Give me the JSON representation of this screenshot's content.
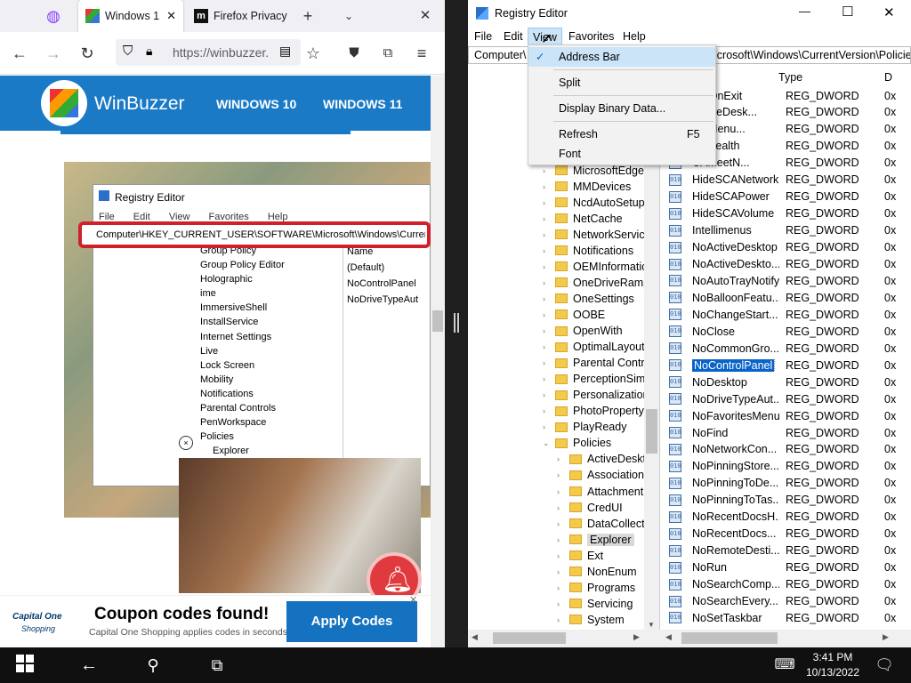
{
  "firefox": {
    "tabs": [
      {
        "label": "Windows 1",
        "favicon": "winbuzzer-icon"
      },
      {
        "label": "Firefox Privacy",
        "favicon": "m-icon"
      }
    ],
    "url": "https://winbuzzer."
  },
  "page": {
    "site_name": "WinBuzzer",
    "nav": [
      "WINDOWS 10",
      "WINDOWS 11"
    ],
    "inner_regedit": {
      "title": "Registry Editor",
      "menu": [
        "File",
        "Edit",
        "View",
        "Favorites",
        "Help"
      ],
      "address": "Computer\\HKEY_CURRENT_USER\\SOFTWARE\\Microsoft\\Windows\\CurrentVer",
      "tree": [
        "Group Policy",
        "Group Policy Editor",
        "Holographic",
        "ime",
        "ImmersiveShell",
        "InstallService",
        "Internet Settings",
        "Live",
        "Lock Screen",
        "Mobility",
        "Notifications",
        "Parental Controls",
        "PenWorkspace",
        "Policies",
        "Explorer"
      ],
      "list_header": "Name",
      "list": [
        "(Default)",
        "NoControlPanel",
        "NoDriveTypeAut"
      ]
    },
    "ad": {
      "brand_top": "Capital One",
      "brand_bottom": "Shopping",
      "headline": "Coupon codes found!",
      "subtext": "Capital One Shopping applies codes in seconds.",
      "button": "Apply Codes"
    }
  },
  "regedit": {
    "title": "Registry Editor",
    "window_controls": [
      "—",
      "☐",
      "✕"
    ],
    "menu": [
      "File",
      "Edit",
      "View",
      "Favorites",
      "Help"
    ],
    "address_left": "Computer\\",
    "address_right": "icrosoft\\Windows\\CurrentVersion\\Policie",
    "view_menu": {
      "items": [
        {
          "label": "Address Bar",
          "checked": true
        },
        {
          "label": "Split"
        },
        {
          "label": "Display Binary Data..."
        },
        {
          "label": "Refresh",
          "shortcut": "F5"
        },
        {
          "label": "Font"
        }
      ]
    },
    "tree": [
      {
        "label": "MicrosoftEdge",
        "indent": 0
      },
      {
        "label": "MMDevices",
        "indent": 0
      },
      {
        "label": "NcdAutoSetup",
        "indent": 0
      },
      {
        "label": "NetCache",
        "indent": 0
      },
      {
        "label": "NetworkService",
        "indent": 0
      },
      {
        "label": "Notifications",
        "indent": 0
      },
      {
        "label": "OEMInformatic",
        "indent": 0
      },
      {
        "label": "OneDriveRamp",
        "indent": 0
      },
      {
        "label": "OneSettings",
        "indent": 0
      },
      {
        "label": "OOBE",
        "indent": 0
      },
      {
        "label": "OpenWith",
        "indent": 0
      },
      {
        "label": "OptimalLayout",
        "indent": 0
      },
      {
        "label": "Parental Contro",
        "indent": 0
      },
      {
        "label": "PerceptionSimu",
        "indent": 0
      },
      {
        "label": "Personalization",
        "indent": 0
      },
      {
        "label": "PhotoPropertyH",
        "indent": 0
      },
      {
        "label": "PlayReady",
        "indent": 0
      },
      {
        "label": "Policies",
        "indent": 0,
        "expanded": true
      },
      {
        "label": "ActiveDeskto",
        "indent": 1
      },
      {
        "label": "Associations",
        "indent": 1
      },
      {
        "label": "Attachment",
        "indent": 1
      },
      {
        "label": "CredUI",
        "indent": 1
      },
      {
        "label": "DataCollecti",
        "indent": 1
      },
      {
        "label": "Explorer",
        "indent": 1,
        "selected": true
      },
      {
        "label": "Ext",
        "indent": 1
      },
      {
        "label": "NonEnum",
        "indent": 1
      },
      {
        "label": "Programs",
        "indent": 1
      },
      {
        "label": "Servicing",
        "indent": 1
      },
      {
        "label": "System",
        "indent": 1
      }
    ],
    "list_header": {
      "name": "",
      "type": "Type",
      "data": "D"
    },
    "values": [
      {
        "name": "ilesOnExit",
        "type": "REG_DWORD"
      },
      {
        "name": "ActiveDesk...",
        "type": "REG_DWORD"
      },
      {
        "name": "tartMenu...",
        "type": "REG_DWORD"
      },
      {
        "name": "CAHealth",
        "type": "REG_DWORD"
      },
      {
        "name": "CAMeetN...",
        "type": "REG_DWORD"
      },
      {
        "name": "HideSCANetwork",
        "type": "REG_DWORD"
      },
      {
        "name": "HideSCAPower",
        "type": "REG_DWORD"
      },
      {
        "name": "HideSCAVolume",
        "type": "REG_DWORD"
      },
      {
        "name": "Intellimenus",
        "type": "REG_DWORD"
      },
      {
        "name": "NoActiveDesktop",
        "type": "REG_DWORD"
      },
      {
        "name": "NoActiveDeskto...",
        "type": "REG_DWORD"
      },
      {
        "name": "NoAutoTrayNotify",
        "type": "REG_DWORD"
      },
      {
        "name": "NoBalloonFeatu...",
        "type": "REG_DWORD"
      },
      {
        "name": "NoChangeStart...",
        "type": "REG_DWORD"
      },
      {
        "name": "NoClose",
        "type": "REG_DWORD"
      },
      {
        "name": "NoCommonGro...",
        "type": "REG_DWORD"
      },
      {
        "name": "NoControlPanel",
        "type": "REG_DWORD",
        "selected": true
      },
      {
        "name": "NoDesktop",
        "type": "REG_DWORD"
      },
      {
        "name": "NoDriveTypeAut...",
        "type": "REG_DWORD"
      },
      {
        "name": "NoFavoritesMenu",
        "type": "REG_DWORD"
      },
      {
        "name": "NoFind",
        "type": "REG_DWORD"
      },
      {
        "name": "NoNetworkCon...",
        "type": "REG_DWORD"
      },
      {
        "name": "NoPinningStore...",
        "type": "REG_DWORD"
      },
      {
        "name": "NoPinningToDe...",
        "type": "REG_DWORD"
      },
      {
        "name": "NoPinningToTas...",
        "type": "REG_DWORD"
      },
      {
        "name": "NoRecentDocsH...",
        "type": "REG_DWORD"
      },
      {
        "name": "NoRecentDocs...",
        "type": "REG_DWORD"
      },
      {
        "name": "NoRemoteDesti...",
        "type": "REG_DWORD"
      },
      {
        "name": "NoRun",
        "type": "REG_DWORD"
      },
      {
        "name": "NoSearchComp...",
        "type": "REG_DWORD"
      },
      {
        "name": "NoSearchEvery...",
        "type": "REG_DWORD"
      },
      {
        "name": "NoSetTaskbar",
        "type": "REG_DWORD"
      }
    ],
    "data_col_prefix": "0x"
  },
  "taskbar": {
    "time": "3:41 PM",
    "date": "10/13/2022"
  }
}
